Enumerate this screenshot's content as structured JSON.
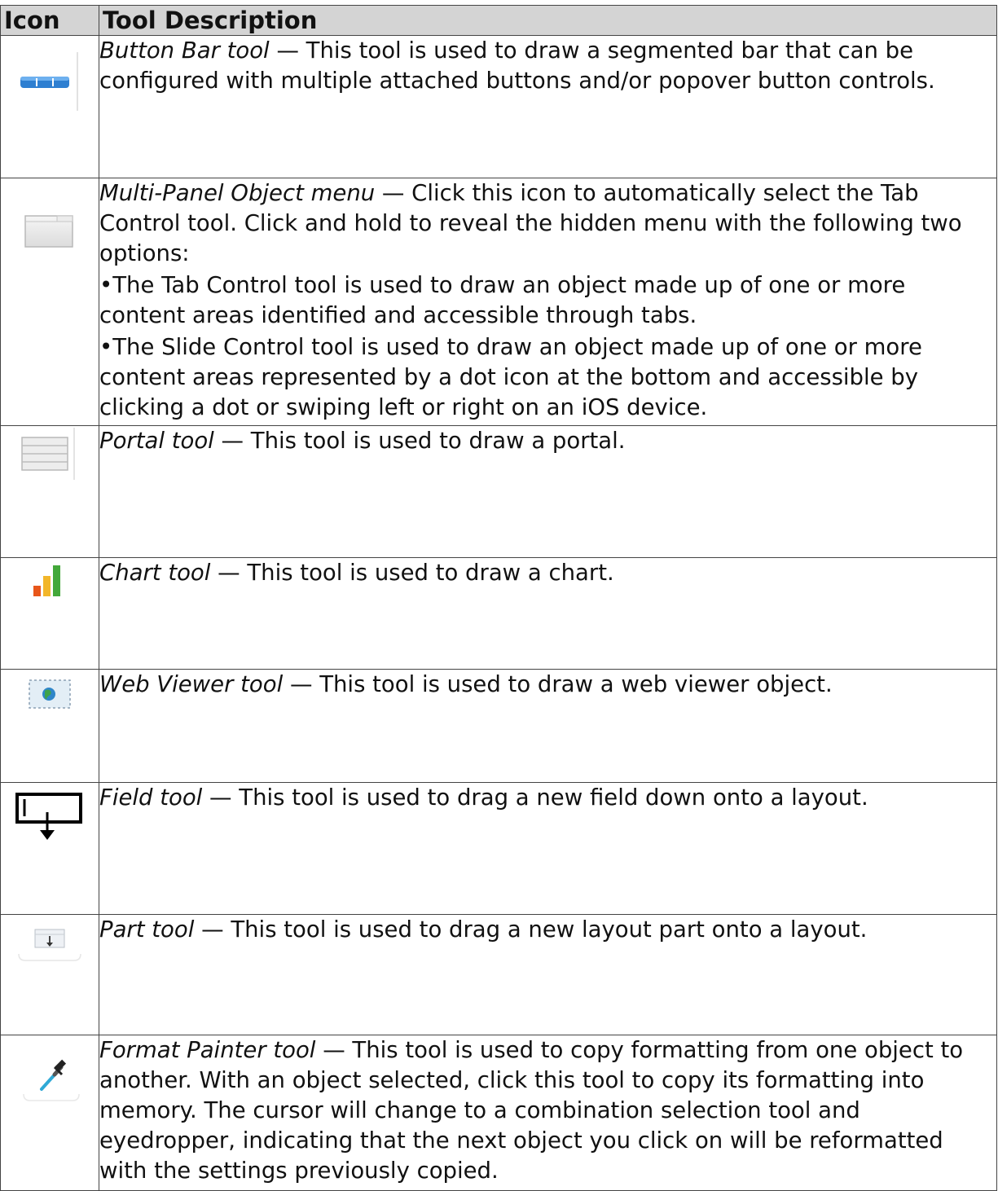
{
  "header": {
    "icon_col": "Icon",
    "desc_col": "Tool Description"
  },
  "rows": [
    {
      "icon": "button-bar-icon",
      "name": "Button Bar tool",
      "text": " — This tool is used to draw a segmented bar that can be configured with multiple attached buttons and/or popover button controls.",
      "extra": []
    },
    {
      "icon": "multi-panel-icon",
      "name": "Multi-Panel Object menu",
      "text": " — Click this icon to automatically select the Tab Control tool. Click and hold to reveal the hidden menu with the following two options:",
      "extra": [
        "•The Tab Control tool is used to draw an object made up of one or more content areas identified and accessible through tabs.",
        "•The Slide Control tool is used to draw an object made up of one or more content areas represented by a dot icon at the bottom and accessible by clicking a dot or swiping left or right on an iOS device."
      ]
    },
    {
      "icon": "portal-icon",
      "name": "Portal tool",
      "text": " — This tool is used to draw a portal.",
      "extra": []
    },
    {
      "icon": "chart-icon",
      "name": "Chart tool",
      "text": " — This tool is used to draw a chart.",
      "extra": []
    },
    {
      "icon": "web-viewer-icon",
      "name": "Web Viewer tool",
      "text": " — This tool is used to draw a web viewer object.",
      "extra": []
    },
    {
      "icon": "field-icon",
      "name": "Field tool",
      "text": " — This tool is used to drag a new field down onto a layout.",
      "extra": []
    },
    {
      "icon": "part-icon",
      "name": "Part tool",
      "text": " — This tool is used to drag a new layout part onto a layout.",
      "extra": []
    },
    {
      "icon": "eyedropper-icon",
      "name": "Format Painter tool",
      "text": " — This tool is used to copy formatting from one object to another. With an object selected, click this tool to copy its formatting into memory. The cursor will change to a combination selection tool and eyedropper, indicating that the next object you click on will be reformatted with the settings previously copied.",
      "extra": []
    }
  ]
}
